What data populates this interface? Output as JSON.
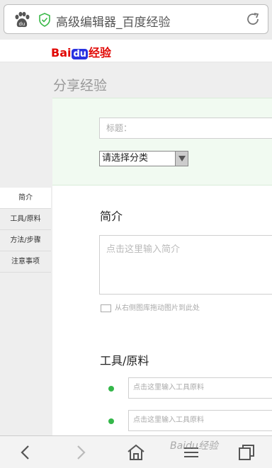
{
  "browser": {
    "tab_title": "高级编辑器_百度经验",
    "paw_icon": "paw-icon",
    "secure_icon": "shield-check-icon",
    "reload_icon": "reload-icon"
  },
  "site": {
    "logo": {
      "part1": "Bai",
      "part2": "du",
      "part3": "经验"
    }
  },
  "page": {
    "title": "分享经验",
    "title_placeholder": "标题：",
    "category_select": "请选择分类"
  },
  "leftnav": {
    "items": [
      {
        "label": "简介"
      },
      {
        "label": "工具/原料"
      },
      {
        "label": "方法/步骤"
      },
      {
        "label": "注意事项"
      }
    ]
  },
  "intro": {
    "heading": "简介",
    "placeholder": "点击这里输入简介",
    "drag_hint": "从右侧图库拖动图片到此处"
  },
  "tools": {
    "heading": "工具/原料",
    "items": [
      {
        "placeholder": "点击这里输入工具原料"
      },
      {
        "placeholder": "点击这里输入工具原料"
      }
    ]
  },
  "bottombar": {
    "back_icon": "back-icon",
    "forward_icon": "forward-icon",
    "home_icon": "home-icon",
    "menu_icon": "menu-icon",
    "tabs_icon": "tabs-icon",
    "watermark": "Baidu经验"
  },
  "colors": {
    "brand_red": "#e10602",
    "brand_blue": "#2932e1",
    "accent_green": "#34b74a"
  }
}
